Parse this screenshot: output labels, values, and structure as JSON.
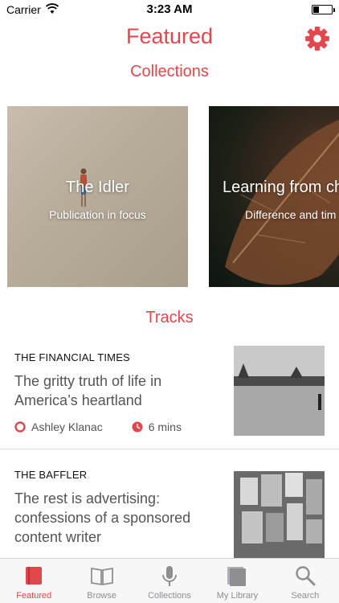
{
  "status_bar": {
    "carrier": "Carrier",
    "time": "3:23 AM",
    "battery_level": 0.3
  },
  "header": {
    "title": "Featured",
    "settings_icon": "gear-icon"
  },
  "collections": {
    "heading": "Collections",
    "cards": [
      {
        "title": "The Idler",
        "subtitle": "Publication in focus"
      },
      {
        "title": "Learning from ch",
        "subtitle": "Difference and tim"
      }
    ]
  },
  "tracks": {
    "heading": "Tracks",
    "items": [
      {
        "source": "THE FINANCIAL TIMES",
        "title": "The gritty truth of life in America’s heartland",
        "author": "Ashley Klanac",
        "duration": "6 mins"
      },
      {
        "source": "THE BAFFLER",
        "title": "The rest is advertising: confessions of a sponsored content writer"
      }
    ]
  },
  "tab_bar": {
    "items": [
      {
        "label": "Featured",
        "icon": "book-filled-icon",
        "active": true
      },
      {
        "label": "Browse",
        "icon": "open-book-icon"
      },
      {
        "label": "Collections",
        "icon": "microphone-icon"
      },
      {
        "label": "My Library",
        "icon": "library-stack-icon"
      },
      {
        "label": "Search",
        "icon": "magnifier-icon"
      }
    ]
  },
  "colors": {
    "accent": "#e0484d",
    "tab_inactive": "#8e8e93"
  }
}
